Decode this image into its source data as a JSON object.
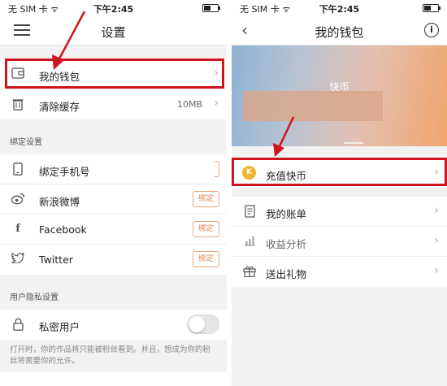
{
  "status": {
    "carrier": "无 SIM 卡 ᯤ",
    "time": "下午2:45"
  },
  "settings": {
    "title": "设置",
    "wallet_label": "我的钱包",
    "clear_cache_label": "清除缓存",
    "cache_size": "10MB",
    "bind_section": "绑定设置",
    "bind_button": "绑定",
    "accounts": {
      "phone": "绑定手机号",
      "weibo": "新浪微博",
      "facebook": "Facebook",
      "twitter": "Twitter"
    },
    "privacy_section": "用户隐私设置",
    "private_user_label": "私密用户",
    "private_note": "打开时，你的作品将只能被粉丝看到。并且，想成为你的粉丝将需要你的允许。"
  },
  "wallet": {
    "title": "我的钱包",
    "coin_label": "快币",
    "recharge_label": "充值快币",
    "bill_label": "我的账单",
    "stats_label": "收益分析",
    "gift_label": "送出礼物"
  },
  "colors": {
    "highlight": "#d0141d",
    "accent": "#e8a47a",
    "coin": "#f0b633"
  },
  "icons": {
    "menu": "menu-icon",
    "back": "back-icon",
    "info": "info-icon",
    "wallet": "wallet-icon",
    "trash": "trash-icon",
    "phone": "phone-icon",
    "weibo": "weibo-icon",
    "facebook": "facebook-icon",
    "twitter": "twitter-icon",
    "lock": "lock-icon",
    "coin": "coin-icon",
    "bill": "bill-icon",
    "stats": "stats-icon",
    "gift": "gift-icon"
  }
}
